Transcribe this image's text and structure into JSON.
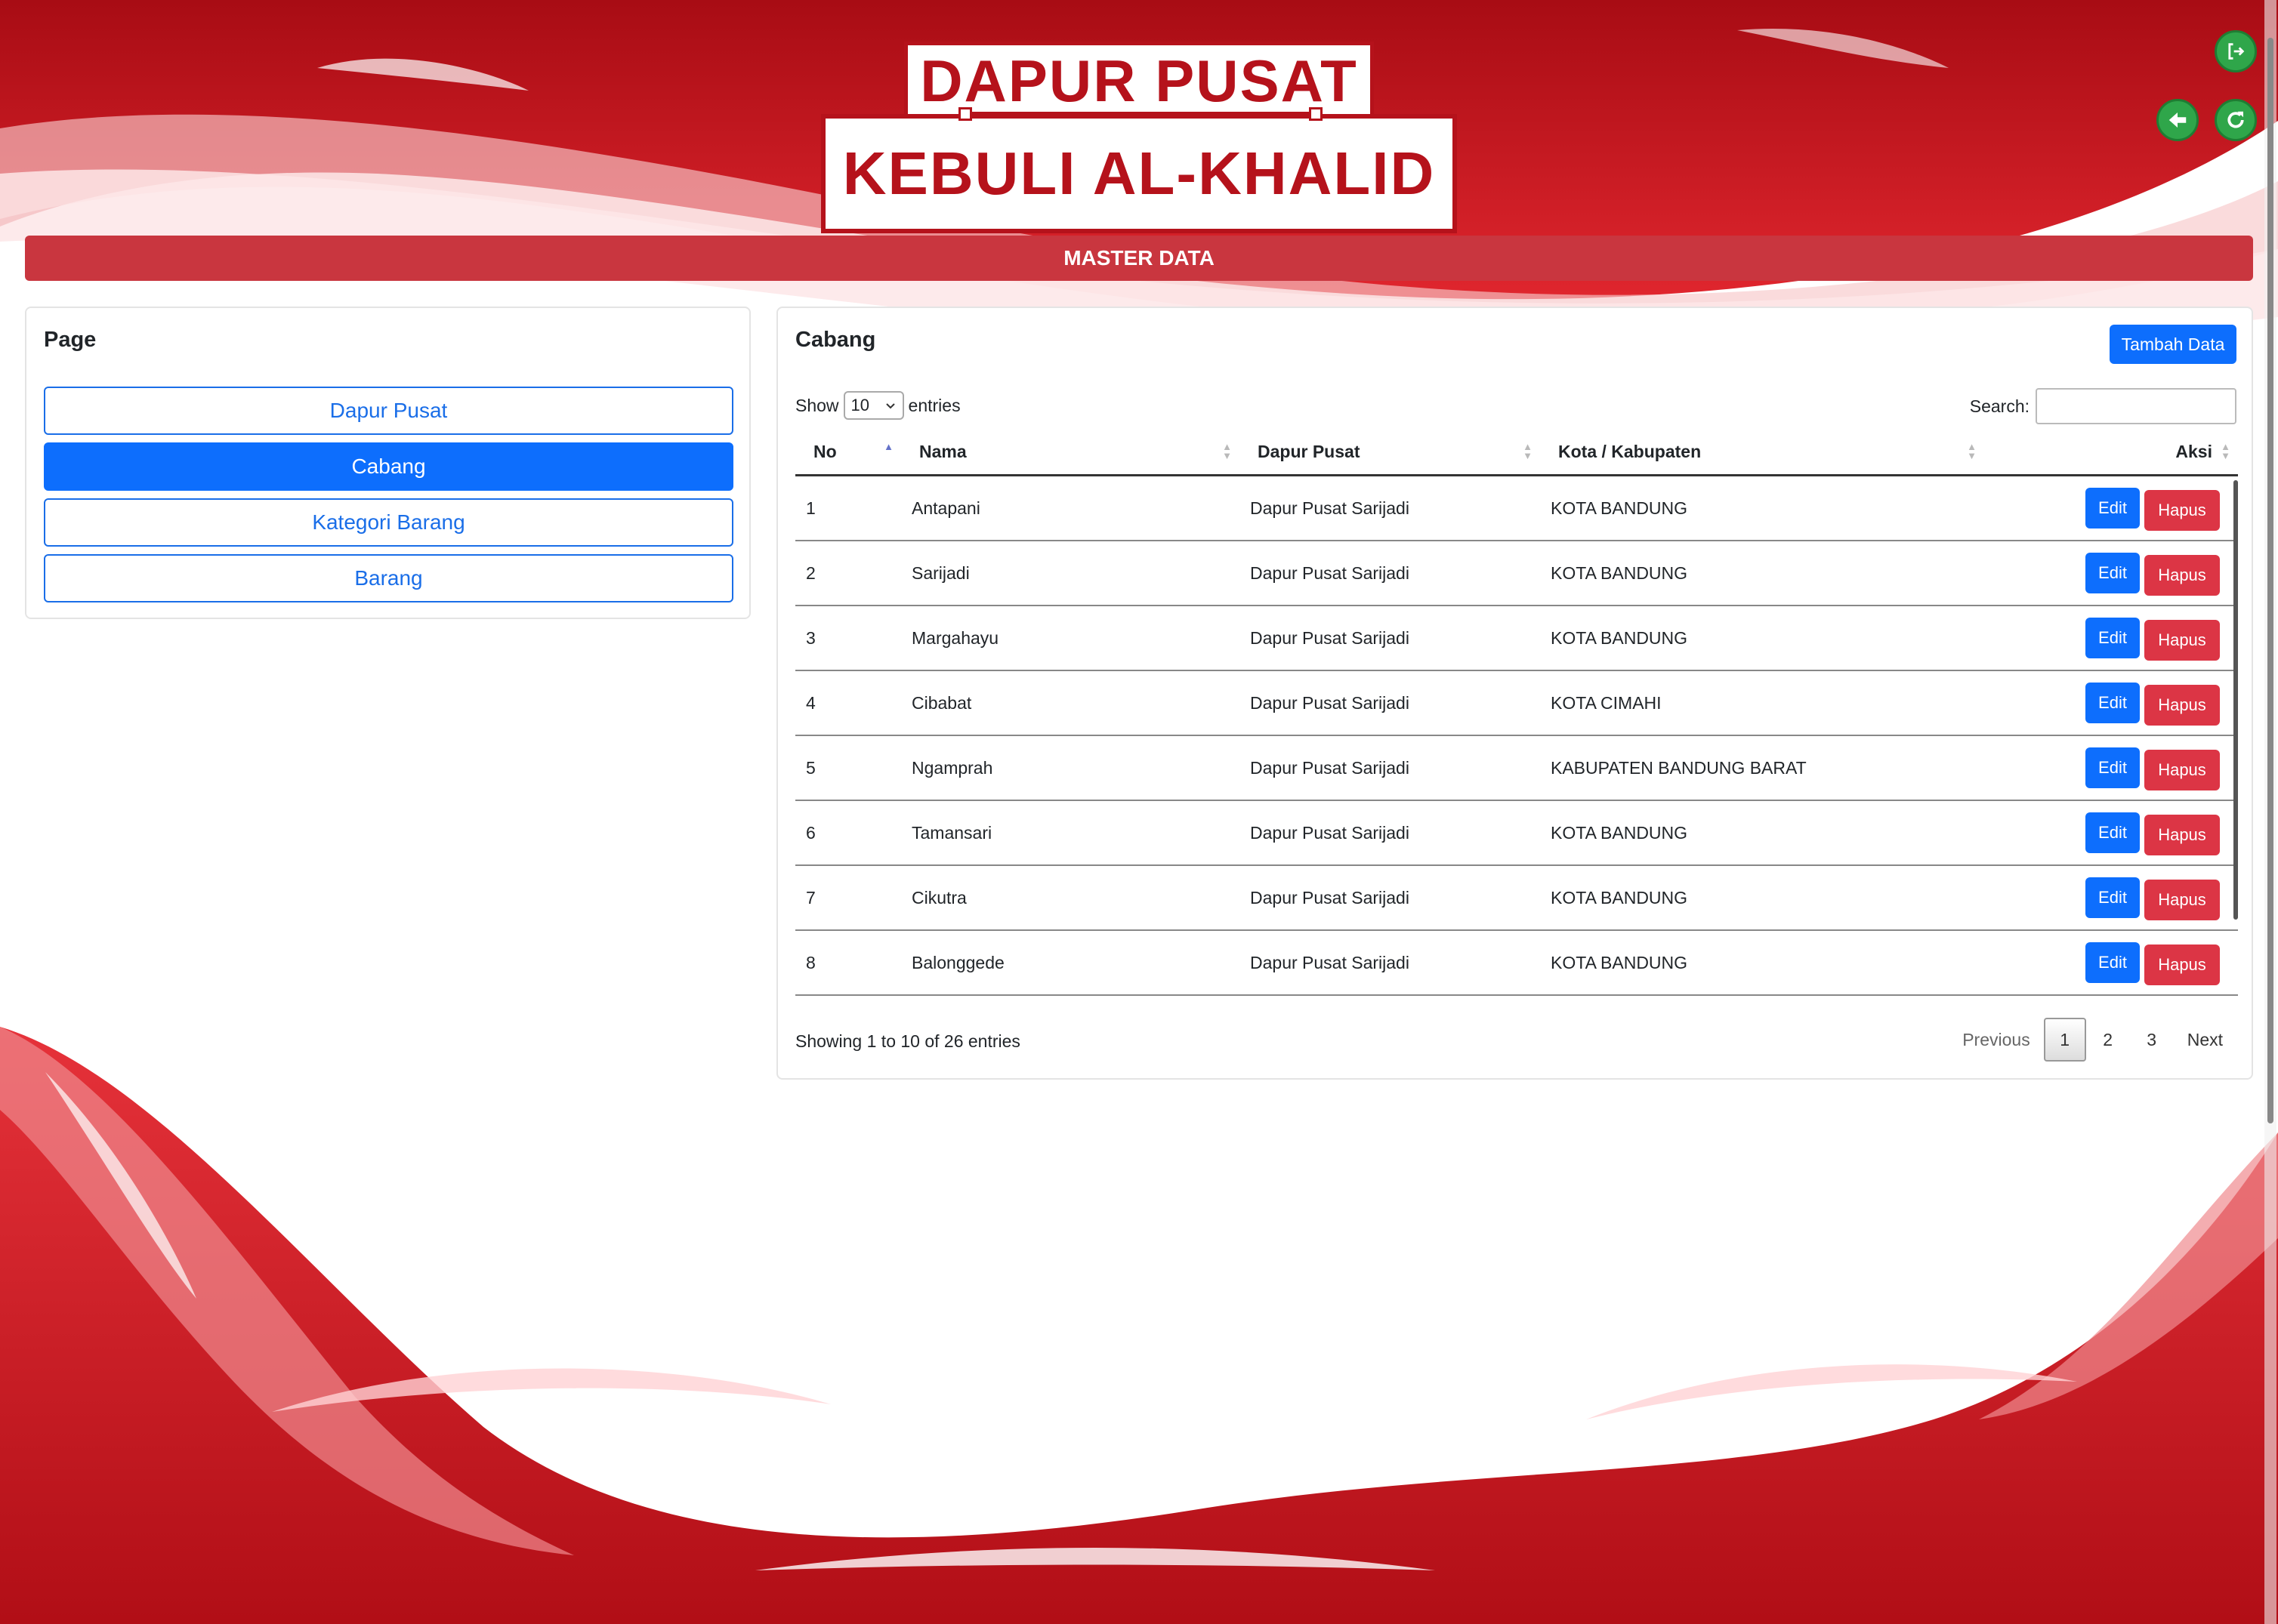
{
  "brand": {
    "line1": "DAPUR PUSAT",
    "line2": "KEBULI AL-KHALID"
  },
  "top_actions": {
    "logout_icon": "logout-icon",
    "back_icon": "arrow-left-icon",
    "refresh_icon": "refresh-icon"
  },
  "section_title": "MASTER DATA",
  "sidebar": {
    "title": "Page",
    "items": [
      {
        "label": "Dapur Pusat",
        "active": false
      },
      {
        "label": "Cabang",
        "active": true
      },
      {
        "label": "Kategori Barang",
        "active": false
      },
      {
        "label": "Barang",
        "active": false
      }
    ]
  },
  "main": {
    "title": "Cabang",
    "add_button": "Tambah Data",
    "show_label": "Show",
    "entries_value": "10",
    "entries_label": "entries",
    "search_label": "Search:",
    "search_value": "",
    "columns": [
      "No",
      "Nama",
      "Dapur Pusat",
      "Kota / Kabupaten",
      "Aksi"
    ],
    "rows": [
      [
        "1",
        "Antapani",
        "Dapur Pusat Sarijadi",
        "KOTA BANDUNG"
      ],
      [
        "2",
        "Sarijadi",
        "Dapur Pusat Sarijadi",
        "KOTA BANDUNG"
      ],
      [
        "3",
        "Margahayu",
        "Dapur Pusat Sarijadi",
        "KOTA BANDUNG"
      ],
      [
        "4",
        "Cibabat",
        "Dapur Pusat Sarijadi",
        "KOTA CIMAHI"
      ],
      [
        "5",
        "Ngamprah",
        "Dapur Pusat Sarijadi",
        "KABUPATEN BANDUNG BARAT"
      ],
      [
        "6",
        "Tamansari",
        "Dapur Pusat Sarijadi",
        "KOTA BANDUNG"
      ],
      [
        "7",
        "Cikutra",
        "Dapur Pusat Sarijadi",
        "KOTA BANDUNG"
      ],
      [
        "8",
        "Balonggede",
        "Dapur Pusat Sarijadi",
        "KOTA BANDUNG"
      ]
    ],
    "edit_label": "Edit",
    "delete_label": "Hapus",
    "info": "Showing 1 to 10 of 26 entries",
    "pagination": {
      "previous": "Previous",
      "pages": [
        "1",
        "2",
        "3"
      ],
      "current": "1",
      "next": "Next"
    }
  },
  "colors": {
    "brand_red": "#b5121b",
    "bar_red": "#c9363f",
    "primary": "#0d6efd",
    "danger": "#dc3545",
    "green": "#2fa64a"
  }
}
